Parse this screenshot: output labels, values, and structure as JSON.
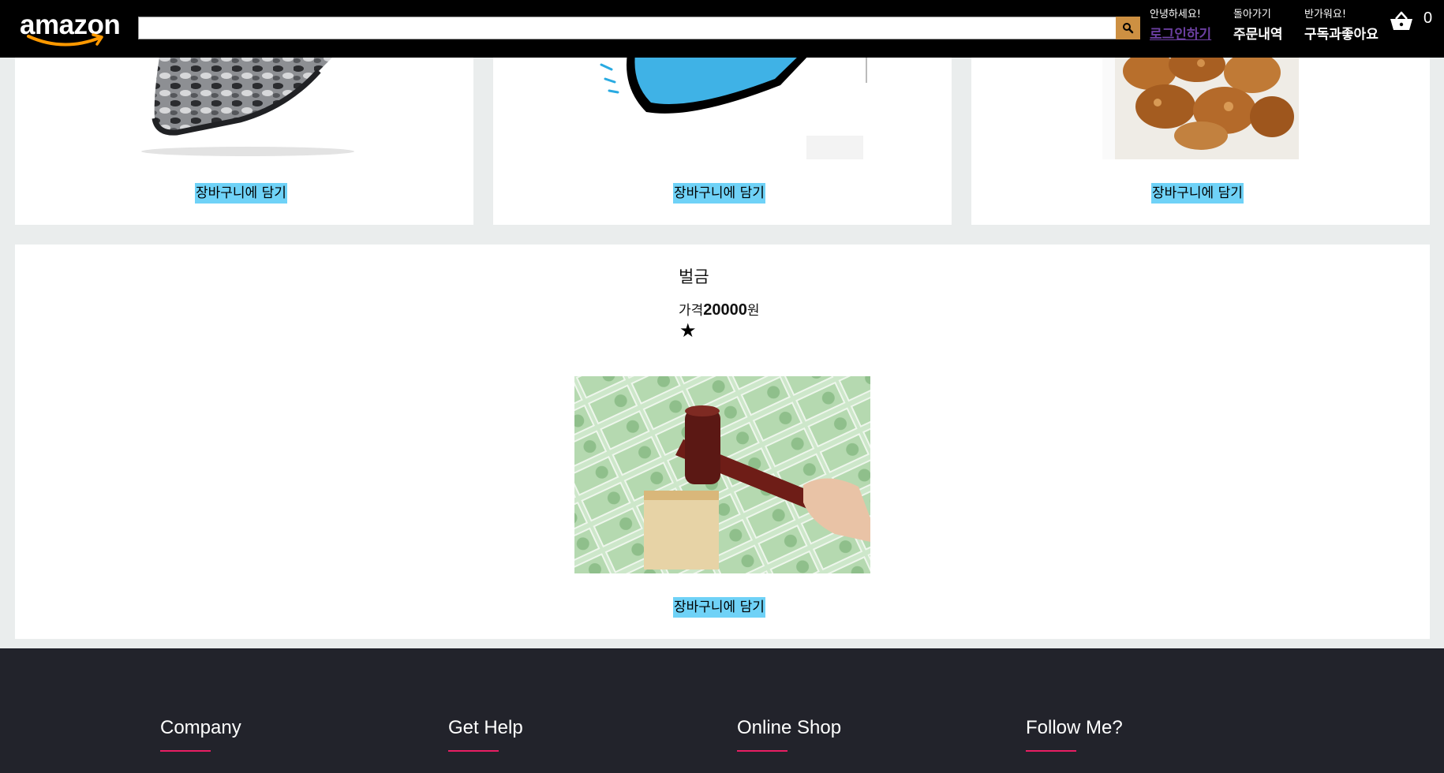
{
  "header": {
    "logo_text": "amazon",
    "search": {
      "placeholder": "",
      "value": ""
    },
    "greeting": {
      "line1": "안녕하세요!",
      "line2": "로그인하기"
    },
    "orders": {
      "line1": "돌아가기",
      "line2": "주문내역"
    },
    "subscribe": {
      "line1": "반가워요!",
      "line2": "구독과좋아요"
    },
    "basket_count": "0"
  },
  "products": [
    {
      "add_to_cart": "장바구니에 담기"
    },
    {
      "add_to_cart": "장바구니에 담기"
    },
    {
      "add_to_cart": "장바구니에 담기"
    },
    {
      "title": "벌금",
      "price_label": "가격",
      "price": "20000",
      "price_unit": "원",
      "rating": "★",
      "add_to_cart": "장바구니에 담기"
    }
  ],
  "footer": {
    "columns": [
      {
        "heading": "Company"
      },
      {
        "heading": "Get Help"
      },
      {
        "heading": "Online Shop"
      },
      {
        "heading": "Follow Me?"
      }
    ]
  },
  "colors": {
    "header_bg": "#000000",
    "search_button": "#cd9042",
    "cart_button": "#6fd2f7",
    "footer_bg": "#22232b",
    "footer_accent": "#e91e63"
  }
}
